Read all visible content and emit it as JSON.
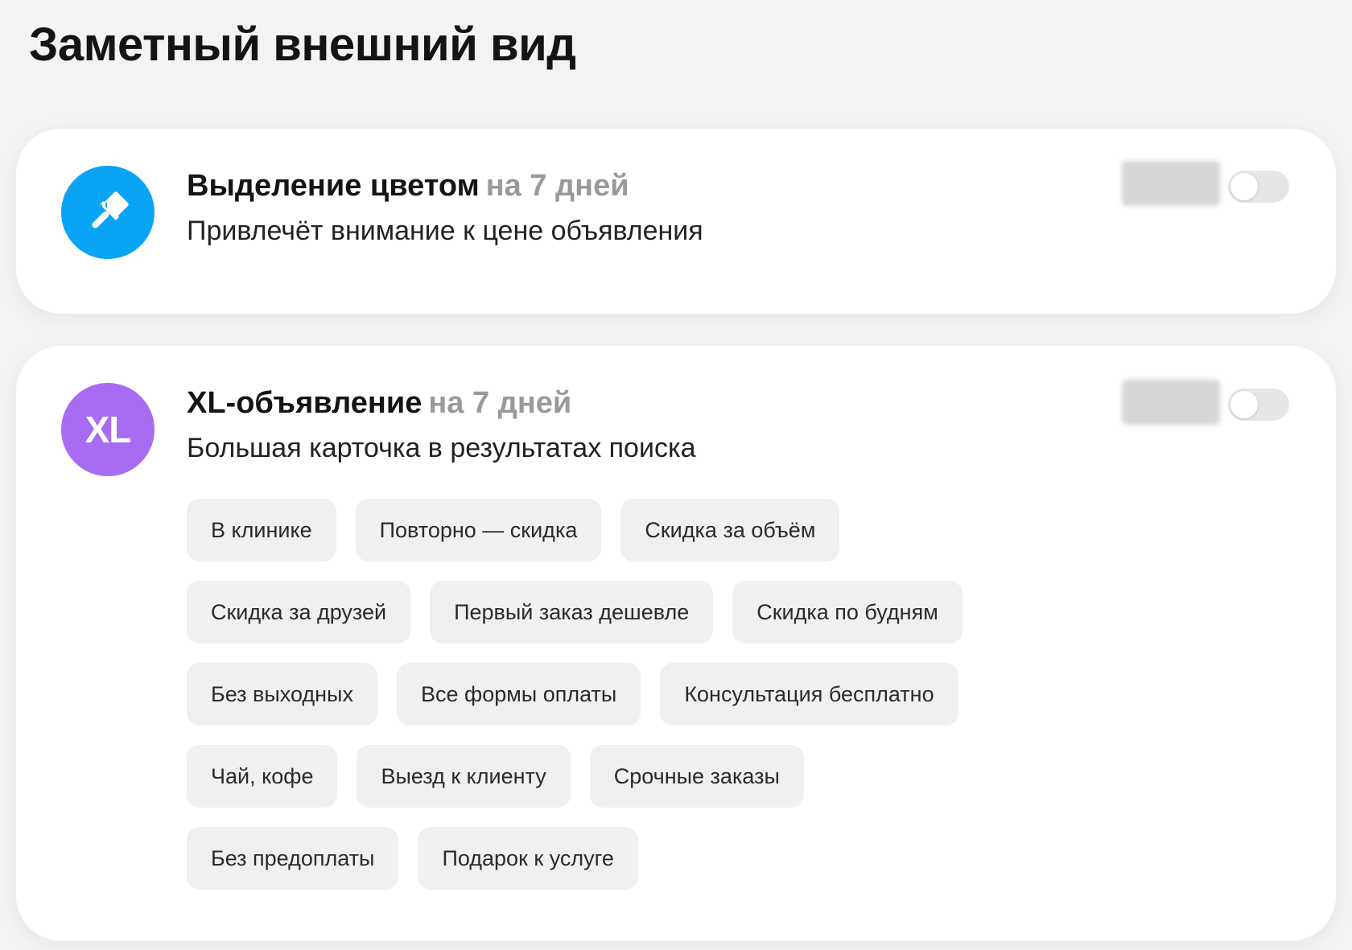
{
  "page": {
    "title": "Заметный внешний вид"
  },
  "services": [
    {
      "icon": "paint-brush-icon",
      "icon_color": "#0aa4f5",
      "title": "Выделение цветом",
      "duration": "на 7 дней",
      "description": "Привлечёт внимание к цене объявления",
      "enabled": false
    },
    {
      "icon": "xl-badge-icon",
      "icon_text": "XL",
      "icon_color": "#a86cf2",
      "title": "XL-объявление",
      "duration": "на 7 дней",
      "description": "Большая карточка в результатах поиска",
      "enabled": false,
      "tags": [
        [
          "В клинике",
          "Повторно — скидка",
          "Скидка за объём"
        ],
        [
          "Скидка за друзей",
          "Первый заказ дешевле",
          "Скидка по будням"
        ],
        [
          "Без выходных",
          "Все формы оплаты",
          "Консультация бесплатно"
        ],
        [
          "Чай, кофе",
          "Выезд к клиенту",
          "Срочные заказы"
        ],
        [
          "Без предоплаты",
          "Подарок к услуге"
        ]
      ]
    }
  ]
}
